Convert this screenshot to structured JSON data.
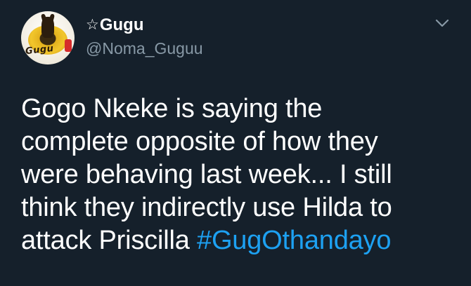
{
  "tweet": {
    "display_name_star": "☆",
    "display_name": "Gugu",
    "handle": "@Noma_Guguu",
    "avatar_text": "Gugu",
    "lines": [
      "Gogo Nkeke is saying the",
      "complete opposite of how they",
      "were behaving last week... I still",
      "think they indirectly use Hilda to",
      "attack Priscilla "
    ],
    "hashtag": "#GugOthandayo"
  },
  "icons": {
    "menu": "chevron-down-icon"
  },
  "colors": {
    "background": "#15202b",
    "text": "#ffffff",
    "secondary": "#8899a6",
    "link": "#1da1f2"
  }
}
